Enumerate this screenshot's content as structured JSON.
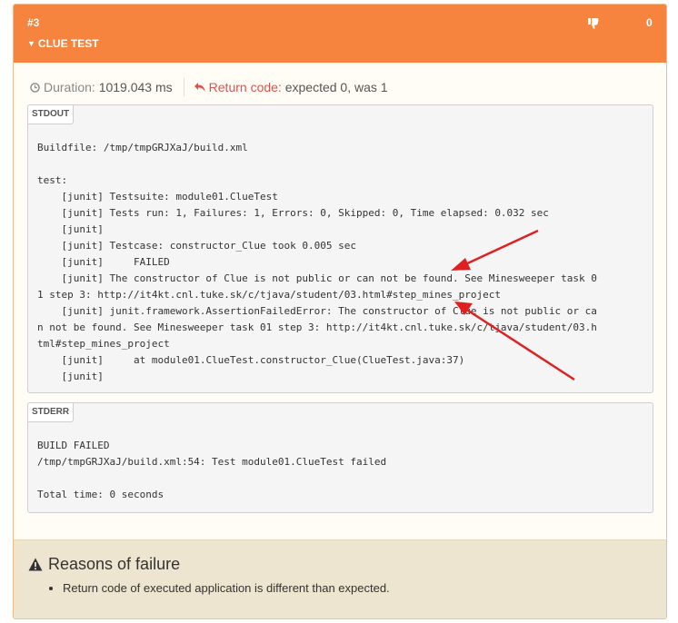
{
  "header": {
    "test_number": "#3",
    "test_title": "CLUE TEST",
    "vote_count": "0",
    "accent_color": "#f6843f"
  },
  "meta": {
    "duration_label": "Duration:",
    "duration_value": "1019.043 ms",
    "return_code_label": "Return code:",
    "return_code_value": "expected 0, was 1"
  },
  "stdout": {
    "label": "STDOUT",
    "text": "Buildfile: /tmp/tmpGRJXaJ/build.xml\n\ntest:\n    [junit] Testsuite: module01.ClueTest\n    [junit] Tests run: 1, Failures: 1, Errors: 0, Skipped: 0, Time elapsed: 0.032 sec\n    [junit]\n    [junit] Testcase: constructor_Clue took 0.005 sec\n    [junit] \tFAILED\n    [junit] The constructor of Clue is not public or can not be found. See Minesweeper task 0\n1 step 3: http://it4kt.cnl.tuke.sk/c/tjava/student/03.html#step_mines_project\n    [junit] junit.framework.AssertionFailedError: The constructor of Clue is not public or ca\nn not be found. See Minesweeper task 01 step 3: http://it4kt.cnl.tuke.sk/c/tjava/student/03.h\ntml#step_mines_project\n    [junit] \tat module01.ClueTest.constructor_Clue(ClueTest.java:37)\n    [junit]"
  },
  "stderr": {
    "label": "STDERR",
    "text": "BUILD FAILED\n/tmp/tmpGRJXaJ/build.xml:54: Test module01.ClueTest failed\n\nTotal time: 0 seconds"
  },
  "reasons": {
    "title": "Reasons of failure",
    "items": [
      "Return code of executed application is different than expected."
    ]
  }
}
